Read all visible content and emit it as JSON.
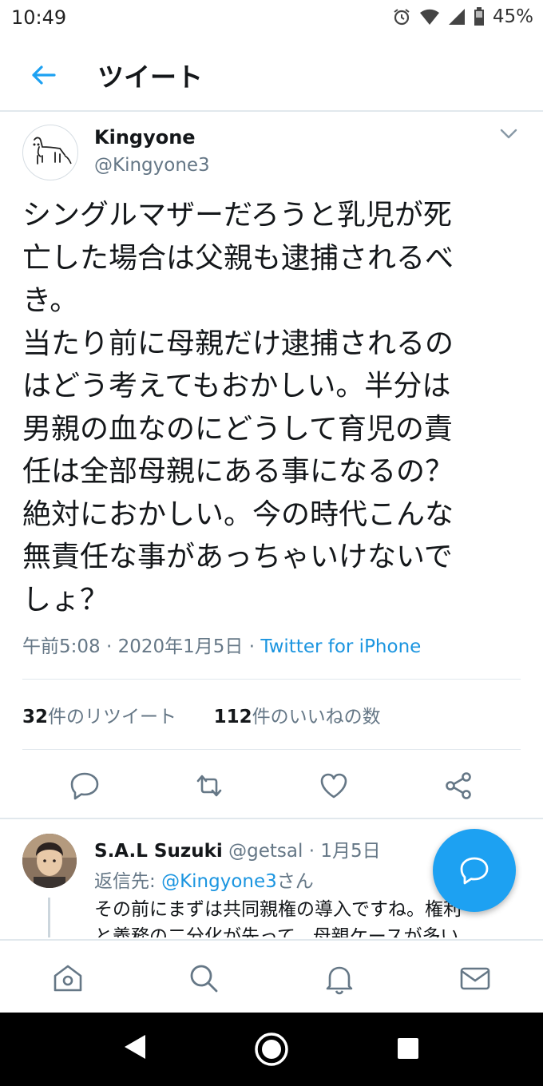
{
  "status_bar": {
    "time": "10:49",
    "battery": "45%"
  },
  "header": {
    "title": "ツイート"
  },
  "tweet": {
    "name": "Kingyone",
    "handle": "@Kingyone3",
    "text_lines": [
      "シングルマザーだろうと乳児が死",
      "亡した場合は父親も逮捕されるべ",
      "き。",
      "当たり前に母親だけ逮捕されるの",
      "はどう考えてもおかしい。半分は",
      "男親の血なのにどうして育児の責",
      "任は全部母親にある事になるの？",
      "絶対におかしい。今の時代こんな",
      "無責任な事があっちゃいけないで",
      "しょ？"
    ],
    "time": "午前5:08",
    "date": "2020年1月5日",
    "separator": "·",
    "source": "Twitter for iPhone",
    "retweets": {
      "count": "32",
      "label": "件のリツイート"
    },
    "likes": {
      "count": "112",
      "label": "件のいいねの数"
    }
  },
  "reply": {
    "name": "S.A.L Suzuki",
    "handle": "@getsal",
    "date": "1月5日",
    "separator": "·",
    "reply_to_label": "返信先: ",
    "reply_to_mention": "@Kingyone3",
    "reply_to_suffix": "さん",
    "text_lines": [
      "その前にまずは共同親権の導入ですね。権利",
      "と義務の二分化が先って、母親ケースが多い"
    ]
  },
  "colors": {
    "accent": "#1da1f2",
    "link": "#1b95e0",
    "secondary": "#657786",
    "border": "#e1e8ed"
  }
}
